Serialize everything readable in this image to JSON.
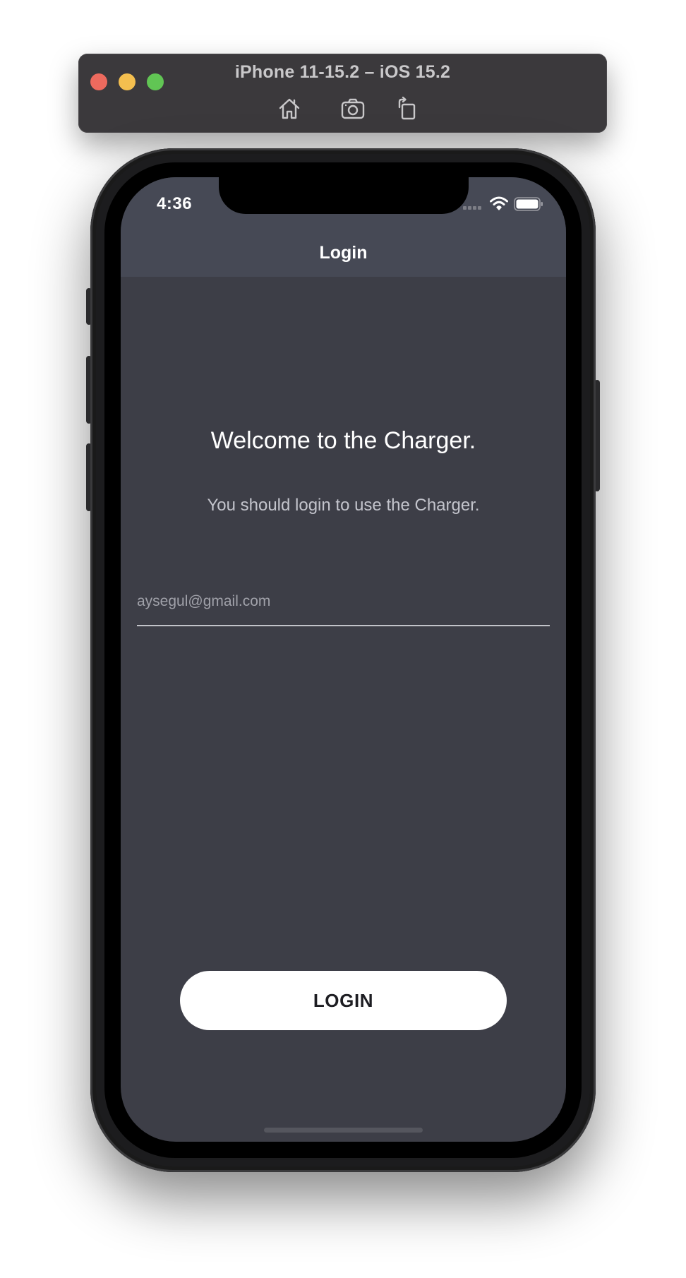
{
  "simulator": {
    "title": "iPhone 11-15.2 – iOS 15.2",
    "tools": [
      {
        "icon": "home-icon",
        "label": "Home"
      },
      {
        "icon": "camera-icon",
        "label": "Screenshot"
      },
      {
        "icon": "rotate-icon",
        "label": "Rotate"
      }
    ]
  },
  "status_bar": {
    "time": "4:36"
  },
  "nav_bar": {
    "title": "Login"
  },
  "content": {
    "welcome_title": "Welcome to the Charger.",
    "welcome_subtitle": "You should login to use the Charger.",
    "email_placeholder": "aysegul@gmail.com",
    "email_value": ""
  },
  "actions": {
    "login_label": "LOGIN"
  },
  "colors": {
    "screen_background": "#3d3e47",
    "nav_background": "#464955",
    "button_background": "#ffffff",
    "button_text": "#1d1d22"
  }
}
